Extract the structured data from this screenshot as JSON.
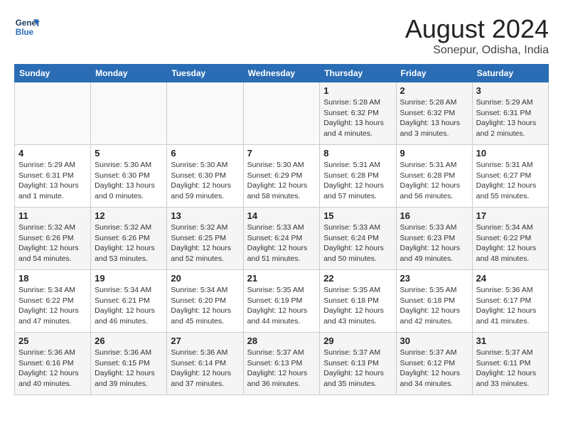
{
  "header": {
    "logo_line1": "General",
    "logo_line2": "Blue",
    "month_year": "August 2024",
    "location": "Sonepur, Odisha, India"
  },
  "weekdays": [
    "Sunday",
    "Monday",
    "Tuesday",
    "Wednesday",
    "Thursday",
    "Friday",
    "Saturday"
  ],
  "weeks": [
    [
      {
        "day": "",
        "info": ""
      },
      {
        "day": "",
        "info": ""
      },
      {
        "day": "",
        "info": ""
      },
      {
        "day": "",
        "info": ""
      },
      {
        "day": "1",
        "info": "Sunrise: 5:28 AM\nSunset: 6:32 PM\nDaylight: 13 hours\nand 4 minutes."
      },
      {
        "day": "2",
        "info": "Sunrise: 5:28 AM\nSunset: 6:32 PM\nDaylight: 13 hours\nand 3 minutes."
      },
      {
        "day": "3",
        "info": "Sunrise: 5:29 AM\nSunset: 6:31 PM\nDaylight: 13 hours\nand 2 minutes."
      }
    ],
    [
      {
        "day": "4",
        "info": "Sunrise: 5:29 AM\nSunset: 6:31 PM\nDaylight: 13 hours\nand 1 minute."
      },
      {
        "day": "5",
        "info": "Sunrise: 5:30 AM\nSunset: 6:30 PM\nDaylight: 13 hours\nand 0 minutes."
      },
      {
        "day": "6",
        "info": "Sunrise: 5:30 AM\nSunset: 6:30 PM\nDaylight: 12 hours\nand 59 minutes."
      },
      {
        "day": "7",
        "info": "Sunrise: 5:30 AM\nSunset: 6:29 PM\nDaylight: 12 hours\nand 58 minutes."
      },
      {
        "day": "8",
        "info": "Sunrise: 5:31 AM\nSunset: 6:28 PM\nDaylight: 12 hours\nand 57 minutes."
      },
      {
        "day": "9",
        "info": "Sunrise: 5:31 AM\nSunset: 6:28 PM\nDaylight: 12 hours\nand 56 minutes."
      },
      {
        "day": "10",
        "info": "Sunrise: 5:31 AM\nSunset: 6:27 PM\nDaylight: 12 hours\nand 55 minutes."
      }
    ],
    [
      {
        "day": "11",
        "info": "Sunrise: 5:32 AM\nSunset: 6:26 PM\nDaylight: 12 hours\nand 54 minutes."
      },
      {
        "day": "12",
        "info": "Sunrise: 5:32 AM\nSunset: 6:26 PM\nDaylight: 12 hours\nand 53 minutes."
      },
      {
        "day": "13",
        "info": "Sunrise: 5:32 AM\nSunset: 6:25 PM\nDaylight: 12 hours\nand 52 minutes."
      },
      {
        "day": "14",
        "info": "Sunrise: 5:33 AM\nSunset: 6:24 PM\nDaylight: 12 hours\nand 51 minutes."
      },
      {
        "day": "15",
        "info": "Sunrise: 5:33 AM\nSunset: 6:24 PM\nDaylight: 12 hours\nand 50 minutes."
      },
      {
        "day": "16",
        "info": "Sunrise: 5:33 AM\nSunset: 6:23 PM\nDaylight: 12 hours\nand 49 minutes."
      },
      {
        "day": "17",
        "info": "Sunrise: 5:34 AM\nSunset: 6:22 PM\nDaylight: 12 hours\nand 48 minutes."
      }
    ],
    [
      {
        "day": "18",
        "info": "Sunrise: 5:34 AM\nSunset: 6:22 PM\nDaylight: 12 hours\nand 47 minutes."
      },
      {
        "day": "19",
        "info": "Sunrise: 5:34 AM\nSunset: 6:21 PM\nDaylight: 12 hours\nand 46 minutes."
      },
      {
        "day": "20",
        "info": "Sunrise: 5:34 AM\nSunset: 6:20 PM\nDaylight: 12 hours\nand 45 minutes."
      },
      {
        "day": "21",
        "info": "Sunrise: 5:35 AM\nSunset: 6:19 PM\nDaylight: 12 hours\nand 44 minutes."
      },
      {
        "day": "22",
        "info": "Sunrise: 5:35 AM\nSunset: 6:18 PM\nDaylight: 12 hours\nand 43 minutes."
      },
      {
        "day": "23",
        "info": "Sunrise: 5:35 AM\nSunset: 6:18 PM\nDaylight: 12 hours\nand 42 minutes."
      },
      {
        "day": "24",
        "info": "Sunrise: 5:36 AM\nSunset: 6:17 PM\nDaylight: 12 hours\nand 41 minutes."
      }
    ],
    [
      {
        "day": "25",
        "info": "Sunrise: 5:36 AM\nSunset: 6:16 PM\nDaylight: 12 hours\nand 40 minutes."
      },
      {
        "day": "26",
        "info": "Sunrise: 5:36 AM\nSunset: 6:15 PM\nDaylight: 12 hours\nand 39 minutes."
      },
      {
        "day": "27",
        "info": "Sunrise: 5:36 AM\nSunset: 6:14 PM\nDaylight: 12 hours\nand 37 minutes."
      },
      {
        "day": "28",
        "info": "Sunrise: 5:37 AM\nSunset: 6:13 PM\nDaylight: 12 hours\nand 36 minutes."
      },
      {
        "day": "29",
        "info": "Sunrise: 5:37 AM\nSunset: 6:13 PM\nDaylight: 12 hours\nand 35 minutes."
      },
      {
        "day": "30",
        "info": "Sunrise: 5:37 AM\nSunset: 6:12 PM\nDaylight: 12 hours\nand 34 minutes."
      },
      {
        "day": "31",
        "info": "Sunrise: 5:37 AM\nSunset: 6:11 PM\nDaylight: 12 hours\nand 33 minutes."
      }
    ]
  ]
}
